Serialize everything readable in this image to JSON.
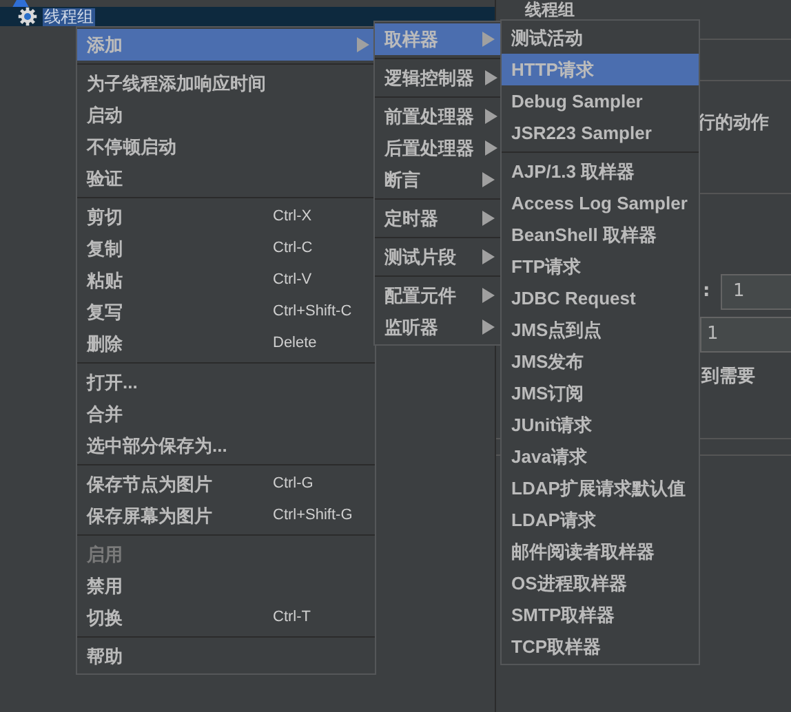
{
  "tree": [
    {
      "kind": "plan",
      "selected": false
    },
    {
      "label": "线程组",
      "kind": "group",
      "selected": true
    }
  ],
  "panel": {
    "title": "线程组",
    "texts": [
      "行的动作",
      ":",
      "到需要"
    ],
    "fields": [
      "1",
      "1"
    ]
  },
  "context_menu": {
    "groups": [
      [
        {
          "label": "添加",
          "selected": true,
          "disabled": false,
          "submenu": true
        }
      ],
      [
        {
          "label": "为子线程添加响应时间",
          "selected": false,
          "disabled": false,
          "submenu": false
        },
        {
          "label": "启动",
          "selected": false,
          "disabled": false,
          "submenu": false
        },
        {
          "label": "不停顿启动",
          "selected": false,
          "disabled": false,
          "submenu": false
        },
        {
          "label": "验证",
          "selected": false,
          "disabled": false,
          "submenu": false
        }
      ],
      [
        {
          "label": "剪切",
          "shortcut": "Ctrl-X",
          "selected": false,
          "disabled": false,
          "submenu": false
        },
        {
          "label": "复制",
          "shortcut": "Ctrl-C",
          "selected": false,
          "disabled": false,
          "submenu": false
        },
        {
          "label": "粘贴",
          "shortcut": "Ctrl-V",
          "selected": false,
          "disabled": false,
          "submenu": false
        },
        {
          "label": "复写",
          "shortcut": "Ctrl+Shift-C",
          "selected": false,
          "disabled": false,
          "submenu": false
        },
        {
          "label": "删除",
          "shortcut": "Delete",
          "selected": false,
          "disabled": false,
          "submenu": false
        }
      ],
      [
        {
          "label": "打开...",
          "selected": false,
          "disabled": false,
          "submenu": false
        },
        {
          "label": "合并",
          "selected": false,
          "disabled": false,
          "submenu": false
        },
        {
          "label": "选中部分保存为...",
          "selected": false,
          "disabled": false,
          "submenu": false
        }
      ],
      [
        {
          "label": "保存节点为图片",
          "shortcut": "Ctrl-G",
          "selected": false,
          "disabled": false,
          "submenu": false
        },
        {
          "label": "保存屏幕为图片",
          "shortcut": "Ctrl+Shift-G",
          "selected": false,
          "disabled": false,
          "submenu": false
        }
      ],
      [
        {
          "label": "启用",
          "selected": false,
          "disabled": true,
          "submenu": false
        },
        {
          "label": "禁用",
          "selected": false,
          "disabled": false,
          "submenu": false
        },
        {
          "label": "切换",
          "shortcut": "Ctrl-T",
          "selected": false,
          "disabled": false,
          "submenu": false
        }
      ],
      [
        {
          "label": "帮助",
          "selected": false,
          "disabled": false,
          "submenu": false
        }
      ]
    ]
  },
  "add_menu": {
    "groups": [
      [
        {
          "label": "取样器",
          "selected": true,
          "disabled": false,
          "submenu": true
        }
      ],
      [
        {
          "label": "逻辑控制器",
          "selected": false,
          "disabled": false,
          "submenu": true
        }
      ],
      [
        {
          "label": "前置处理器",
          "selected": false,
          "disabled": false,
          "submenu": true
        },
        {
          "label": "后置处理器",
          "selected": false,
          "disabled": false,
          "submenu": true
        },
        {
          "label": "断言",
          "selected": false,
          "disabled": false,
          "submenu": true
        }
      ],
      [
        {
          "label": "定时器",
          "selected": false,
          "disabled": false,
          "submenu": true
        }
      ],
      [
        {
          "label": "测试片段",
          "selected": false,
          "disabled": false,
          "submenu": true
        }
      ],
      [
        {
          "label": "配置元件",
          "selected": false,
          "disabled": false,
          "submenu": true
        },
        {
          "label": "监听器",
          "selected": false,
          "disabled": false,
          "submenu": true
        }
      ]
    ]
  },
  "sampler_menu": {
    "groups": [
      [
        {
          "label": "测试活动",
          "selected": false,
          "disabled": false,
          "submenu": false
        },
        {
          "label": "HTTP请求",
          "selected": true,
          "disabled": false,
          "submenu": false
        },
        {
          "label": "Debug Sampler",
          "selected": false,
          "disabled": false,
          "submenu": false
        },
        {
          "label": "JSR223 Sampler",
          "selected": false,
          "disabled": false,
          "submenu": false
        }
      ],
      [
        {
          "label": "AJP/1.3 取样器",
          "selected": false,
          "disabled": false,
          "submenu": false
        },
        {
          "label": "Access Log Sampler",
          "selected": false,
          "disabled": false,
          "submenu": false
        },
        {
          "label": "BeanShell 取样器",
          "selected": false,
          "disabled": false,
          "submenu": false
        },
        {
          "label": "FTP请求",
          "selected": false,
          "disabled": false,
          "submenu": false
        },
        {
          "label": "JDBC Request",
          "selected": false,
          "disabled": false,
          "submenu": false
        },
        {
          "label": "JMS点到点",
          "selected": false,
          "disabled": false,
          "submenu": false
        },
        {
          "label": "JMS发布",
          "selected": false,
          "disabled": false,
          "submenu": false
        },
        {
          "label": "JMS订阅",
          "selected": false,
          "disabled": false,
          "submenu": false
        },
        {
          "label": "JUnit请求",
          "selected": false,
          "disabled": false,
          "submenu": false
        },
        {
          "label": "Java请求",
          "selected": false,
          "disabled": false,
          "submenu": false
        },
        {
          "label": "LDAP扩展请求默认值",
          "selected": false,
          "disabled": false,
          "submenu": false
        },
        {
          "label": "LDAP请求",
          "selected": false,
          "disabled": false,
          "submenu": false
        },
        {
          "label": "邮件阅读者取样器",
          "selected": false,
          "disabled": false,
          "submenu": false
        },
        {
          "label": "OS进程取样器",
          "selected": false,
          "disabled": false,
          "submenu": false
        },
        {
          "label": "SMTP取样器",
          "selected": false,
          "disabled": false,
          "submenu": false
        },
        {
          "label": "TCP取样器",
          "selected": false,
          "disabled": false,
          "submenu": false
        }
      ]
    ]
  }
}
